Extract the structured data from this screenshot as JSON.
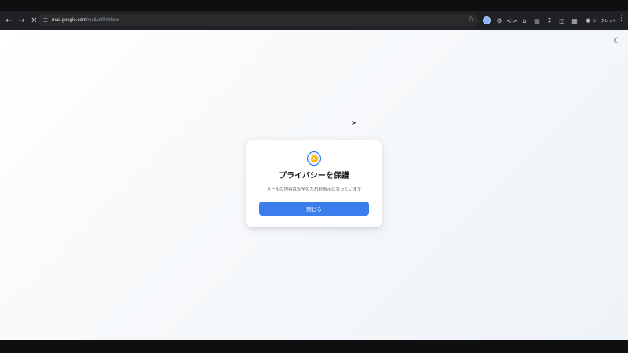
{
  "browser": {
    "url_host": "mail.google.com",
    "url_path": "/mail/u/0/#inbox",
    "incognito_label": "シークレット",
    "icons": {
      "back": "arrow-left-icon",
      "forward": "arrow-right-icon",
      "stop": "close-icon",
      "bookmark": "star-icon",
      "menu": "kebab-menu-icon"
    }
  },
  "page": {
    "theme_toggle_icon": "moon-icon"
  },
  "dialog": {
    "icon": "shield-icon",
    "title": "プライバシーを保護",
    "description": "メールの内容は安全のため非表示になっています",
    "close_button_label": "閉じる"
  },
  "colors": {
    "accent": "#3b7ded",
    "toolbar_bg": "#202124",
    "icon_ring": "#1a73e8",
    "icon_center": "#fbbc04"
  }
}
